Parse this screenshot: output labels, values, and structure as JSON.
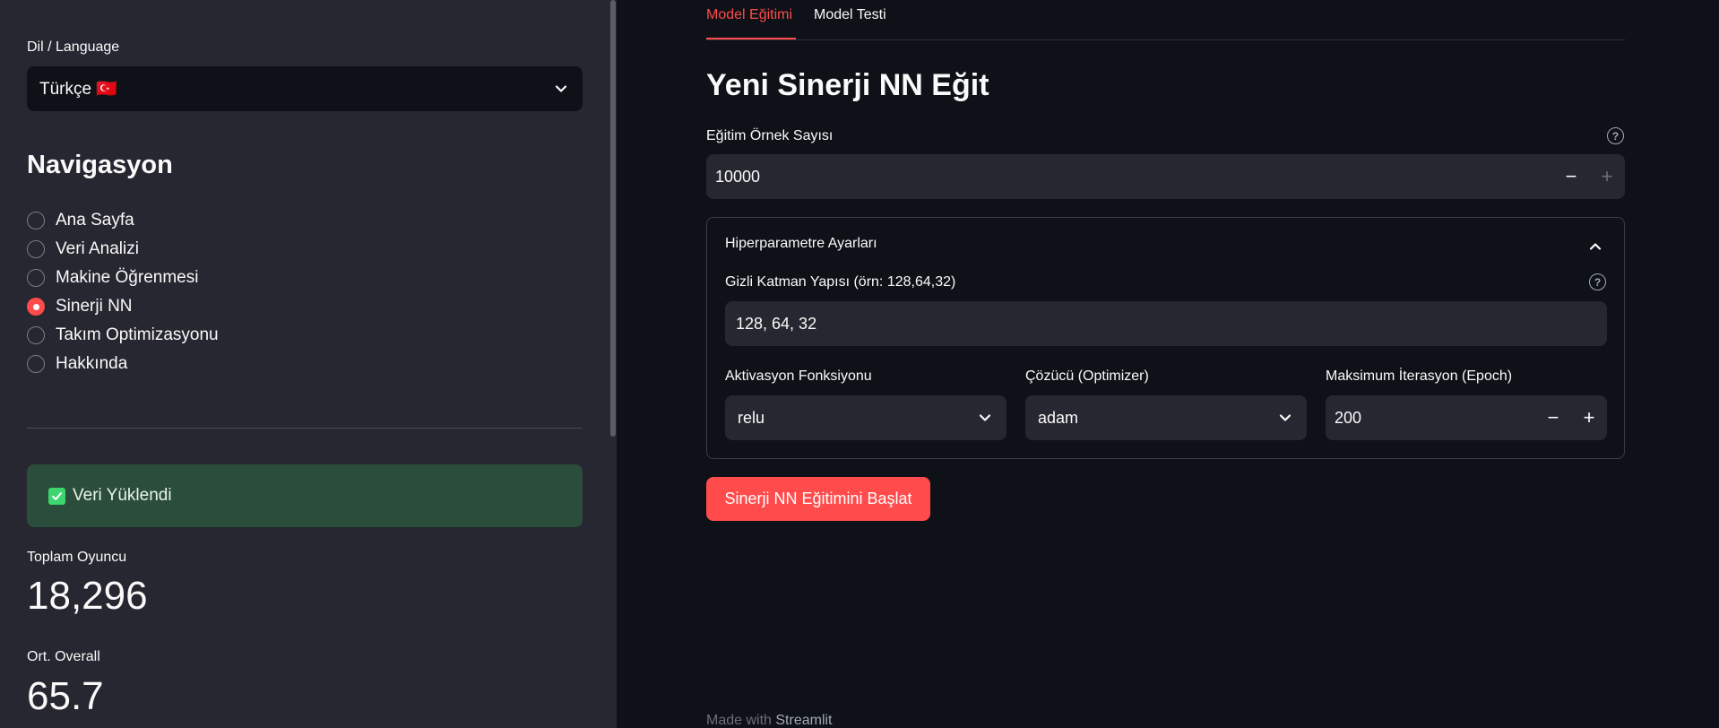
{
  "sidebar": {
    "language_label": "Dil / Language",
    "language_value": "Türkçe 🇹🇷",
    "nav_title": "Navigasyon",
    "nav_items": [
      {
        "label": "Ana Sayfa",
        "selected": false
      },
      {
        "label": "Veri Analizi",
        "selected": false
      },
      {
        "label": "Makine Öğrenmesi",
        "selected": false
      },
      {
        "label": "Sinerji NN",
        "selected": true
      },
      {
        "label": "Takım Optimizasyonu",
        "selected": false
      },
      {
        "label": "Hakkında",
        "selected": false
      }
    ],
    "status_text": "Veri Yüklendi",
    "metrics": [
      {
        "label": "Toplam Oyuncu",
        "value": "18,296"
      },
      {
        "label": "Ort. Overall",
        "value": "65.7"
      }
    ]
  },
  "main": {
    "tabs": [
      {
        "label": "Model Eğitimi",
        "active": true
      },
      {
        "label": "Model Testi",
        "active": false
      }
    ],
    "title": "Yeni Sinerji NN Eğit",
    "sample_count": {
      "label": "Eğitim Örnek Sayısı",
      "value": "10000",
      "minus": "−",
      "plus": "+"
    },
    "expander": {
      "title": "Hiperparametre Ayarları",
      "hidden_layers": {
        "label": "Gizli Katman Yapısı (örn: 128,64,32)",
        "value": "128, 64, 32"
      },
      "activation": {
        "label": "Aktivasyon Fonksiyonu",
        "value": "relu"
      },
      "solver": {
        "label": "Çözücü (Optimizer)",
        "value": "adam"
      },
      "max_iter": {
        "label": "Maksimum İterasyon (Epoch)",
        "value": "200",
        "minus": "−",
        "plus": "+"
      }
    },
    "start_button": "Sinerji NN Eğitimini Başlat",
    "footer": {
      "prefix": "Made with",
      "brand": "Streamlit"
    }
  },
  "colors": {
    "accent": "#ff4b4b",
    "background": "#0e1117",
    "sidebar_bg": "#262730",
    "success_bg": "#2b4d3b"
  }
}
